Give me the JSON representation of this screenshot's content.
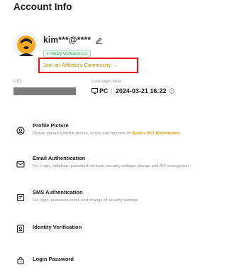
{
  "page": {
    "title": "Account Info"
  },
  "profile": {
    "username": "kim***@****",
    "verification_badge": "Identity Verification Lv.1",
    "affiliate_link": "Join an Affiliate's Community →",
    "uid_label": "UID",
    "last_login_label": "Last login time :",
    "last_login_device": "PC",
    "last_login_time": "2024-03-21 16:22"
  },
  "settings": [
    {
      "title": "Profile Picture",
      "desc": "Please upload a profile picture, or you can buy one on ",
      "desc_highlight": "Bybit's NFT Marketplace",
      "icon": "user-circle-icon"
    },
    {
      "title": "Email Authentication",
      "desc": "For Login, withdraw, password retrieval, security settings change and API management verification",
      "icon": "mail-icon"
    },
    {
      "title": "SMS Authentication",
      "desc": "For login, password reset, and change of security settings",
      "icon": "sms-icon"
    },
    {
      "title": "Identity Verification",
      "desc": "",
      "icon": "id-card-icon"
    },
    {
      "title": "Login Password",
      "desc": "",
      "icon": "lock-icon"
    }
  ],
  "colors": {
    "accent": "#c98a0b",
    "highlight_box": "#e8131b",
    "verified": "#20a85a"
  }
}
